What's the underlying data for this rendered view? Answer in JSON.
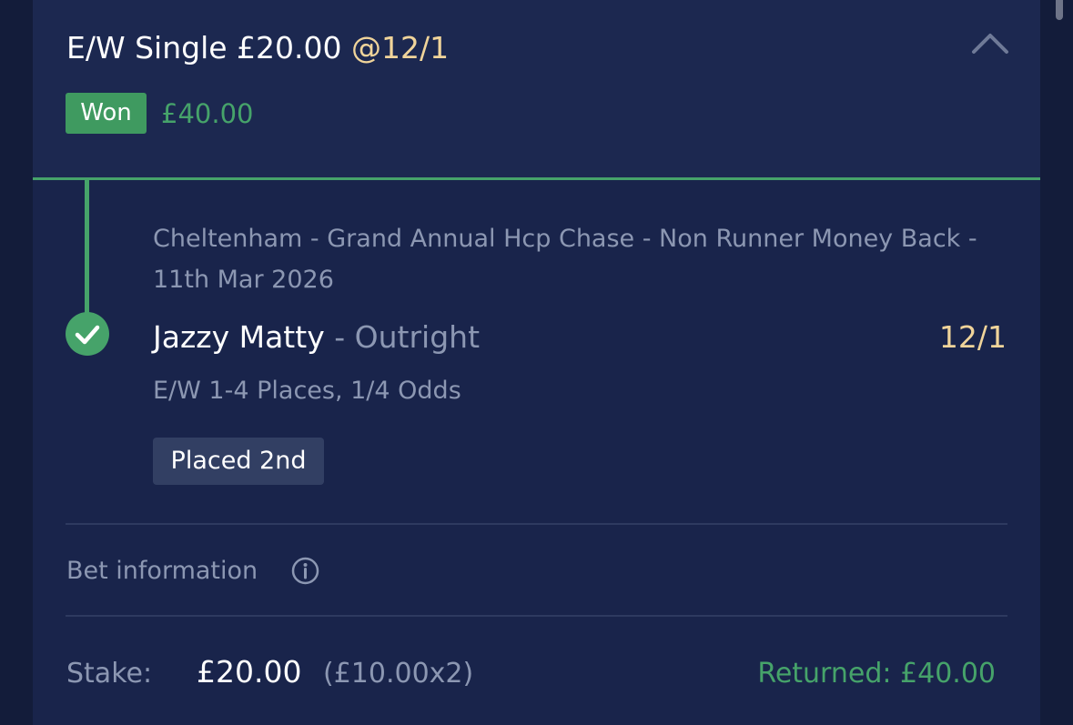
{
  "bet": {
    "title": "E/W Single £20.00",
    "title_odds": "@12/1",
    "status": "Won",
    "won_amount": "£40.00"
  },
  "selection": {
    "event": "Cheltenham - Grand Annual Hcp Chase - Non Runner Money Back - 11th Mar 2026",
    "name": "Jazzy Matty",
    "separator": "-",
    "market": "Outright",
    "odds": "12/1",
    "ew_terms": "E/W 1-4 Places, 1/4 Odds",
    "result": "Placed 2nd"
  },
  "info": {
    "label": "Bet information"
  },
  "footer": {
    "stake_label": "Stake:",
    "stake_value": "£20.00",
    "stake_breakdown": "(£10.00x2)",
    "returned": "Returned: £40.00"
  },
  "icons": {
    "collapse": "chevron-up-icon",
    "check": "check-circle-icon",
    "info": "info-icon"
  },
  "colors": {
    "background": "#131c3a",
    "card": "#19244b",
    "header": "#1c2850",
    "accent_green": "#46a36a",
    "odds_gold": "#f0d49a",
    "muted_text": "#8c97b2"
  }
}
